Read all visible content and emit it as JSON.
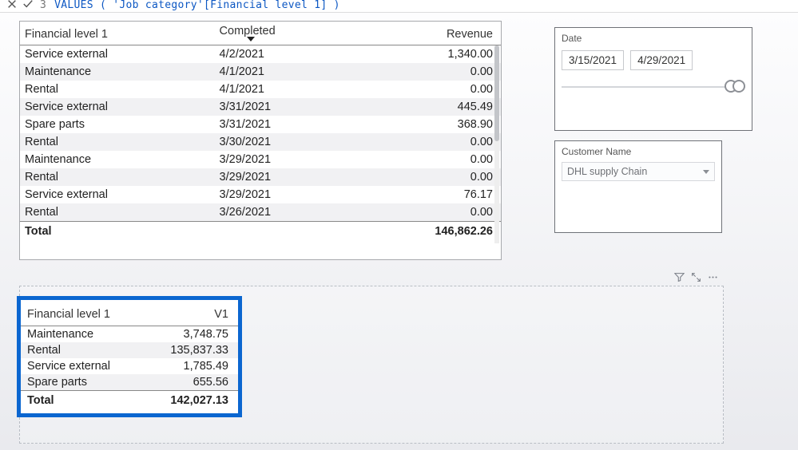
{
  "formula": {
    "line_number": "3",
    "text": "VALUES ( 'Job category'[Financial level 1] )"
  },
  "top_table": {
    "columns": {
      "c0": "Financial level 1",
      "c1": "Completed",
      "c2": "Revenue"
    },
    "rows": [
      {
        "fin": "Service external",
        "date": "4/2/2021",
        "rev": "1,340.00"
      },
      {
        "fin": "Maintenance",
        "date": "4/1/2021",
        "rev": "0.00"
      },
      {
        "fin": "Rental",
        "date": "4/1/2021",
        "rev": "0.00"
      },
      {
        "fin": "Service external",
        "date": "3/31/2021",
        "rev": "445.49"
      },
      {
        "fin": "Spare parts",
        "date": "3/31/2021",
        "rev": "368.90"
      },
      {
        "fin": "Rental",
        "date": "3/30/2021",
        "rev": "0.00"
      },
      {
        "fin": "Maintenance",
        "date": "3/29/2021",
        "rev": "0.00"
      },
      {
        "fin": "Rental",
        "date": "3/29/2021",
        "rev": "0.00"
      },
      {
        "fin": "Service external",
        "date": "3/29/2021",
        "rev": "76.17"
      },
      {
        "fin": "Rental",
        "date": "3/26/2021",
        "rev": "0.00"
      }
    ],
    "total_label": "Total",
    "total_value": "146,862.26"
  },
  "bottom_table": {
    "columns": {
      "c0": "Financial level 1",
      "c1": "V1"
    },
    "rows": [
      {
        "fin": "Maintenance",
        "v1": "3,748.75"
      },
      {
        "fin": "Rental",
        "v1": "135,837.33"
      },
      {
        "fin": "Service external",
        "v1": "1,785.49"
      },
      {
        "fin": "Spare parts",
        "v1": "655.56"
      }
    ],
    "total_label": "Total",
    "total_value": "142,027.13"
  },
  "slicer_date": {
    "label": "Date",
    "start": "3/15/2021",
    "end": "4/29/2021"
  },
  "slicer_customer": {
    "label": "Customer Name",
    "selected": "DHL supply Chain"
  }
}
